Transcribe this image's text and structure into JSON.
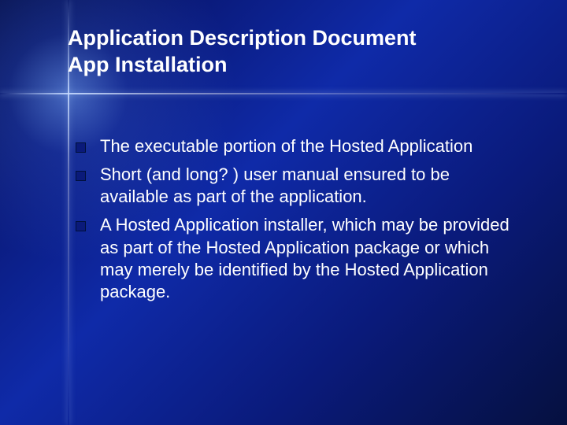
{
  "title_line1": "Application Description Document",
  "title_line2": "App Installation",
  "bullets": [
    "The executable portion of the Hosted Application",
    "Short (and long? ) user manual ensured to be available as part of the application.",
    "A Hosted Application installer, which may be provided as part of the Hosted Application package or which may merely be identified by the Hosted Application package."
  ]
}
